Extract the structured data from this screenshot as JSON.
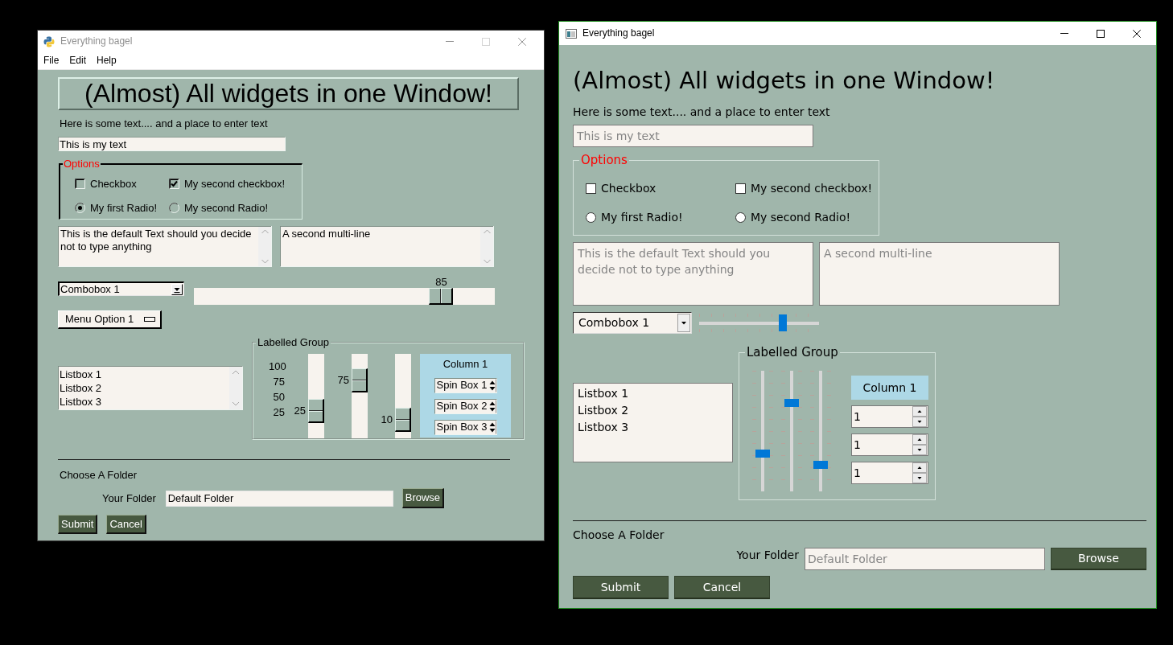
{
  "windows": [
    {
      "kind": "classic",
      "title": "Everything bagel",
      "active": false,
      "controls": [
        {
          "kind": "minimize",
          "disabled": false
        },
        {
          "kind": "maximize",
          "disabled": true
        },
        {
          "kind": "close",
          "disabled": false
        }
      ],
      "menu": [
        "File",
        "Edit",
        "Help"
      ],
      "heading": "(Almost) All widgets in one Window!",
      "intro": "Here is some text.... and a place to enter text",
      "text_input": {
        "value": "This is my text"
      },
      "options": {
        "title": "Options",
        "checkboxes": [
          {
            "label": "Checkbox",
            "checked": false
          },
          {
            "label": "My second checkbox!",
            "checked": true
          }
        ],
        "radios": [
          {
            "label": "My first Radio!",
            "selected": true
          },
          {
            "label": "My second Radio!",
            "selected": false
          }
        ]
      },
      "multilines": [
        {
          "value": "This is the default Text should you decide not to type anything"
        },
        {
          "value": "A second multi-line"
        }
      ],
      "combo": {
        "value": "Combobox 1"
      },
      "slider": {
        "level": 0.85,
        "reading": "85"
      },
      "option_menu": {
        "value": "Menu Option 1"
      },
      "listbox": {
        "items": [
          {
            "label": "Listbox 1",
            "selected": false
          },
          {
            "label": "Listbox 2",
            "selected": false
          },
          {
            "label": "Listbox 3",
            "selected": false
          }
        ]
      },
      "group": {
        "title": "Labelled Group",
        "scale_labels": [
          "100",
          "75",
          "50",
          "25"
        ],
        "sliders": [
          {
            "level": 0.25,
            "reading": "25"
          },
          {
            "level": 0.75,
            "reading": "75"
          },
          {
            "level": 0.1,
            "reading": "10"
          }
        ],
        "column": {
          "title": "Column 1",
          "spinboxes": [
            {
              "value": "Spin Box 1"
            },
            {
              "value": "Spin Box 2"
            },
            {
              "value": "Spin Box 3"
            }
          ]
        }
      },
      "folder": {
        "title": "Choose A Folder",
        "label": "Your Folder",
        "value": "Default Folder",
        "button": "Browse"
      },
      "buttons": [
        "Submit",
        "Cancel"
      ]
    },
    {
      "kind": "modern",
      "title": "Everything bagel",
      "active": true,
      "controls": [
        {
          "kind": "minimize",
          "disabled": false
        },
        {
          "kind": "maximize",
          "disabled": false
        },
        {
          "kind": "close",
          "disabled": false
        }
      ],
      "heading": "(Almost) All widgets in one Window!",
      "intro": "Here is some text.... and a place to enter text",
      "text_input": {
        "placeholder": "This is my text"
      },
      "options": {
        "title": "Options",
        "checkboxes": [
          {
            "label": "Checkbox",
            "checked": false
          },
          {
            "label": "My second checkbox!",
            "checked": false
          }
        ],
        "radios": [
          {
            "label": "My first Radio!",
            "selected": false
          },
          {
            "label": "My second Radio!",
            "selected": false
          }
        ]
      },
      "multilines": [
        {
          "placeholder": "This is the default Text should you decide not to type anything"
        },
        {
          "placeholder": "A second multi-line"
        }
      ],
      "combo": {
        "value": "Combobox 1"
      },
      "slider": {
        "level": 0.71
      },
      "listbox": {
        "items": [
          {
            "label": "Listbox 1",
            "selected": false
          },
          {
            "label": "Listbox 2",
            "selected": false
          },
          {
            "label": "Listbox 3",
            "selected": false
          }
        ]
      },
      "group": {
        "title": "Labelled Group",
        "sliders": [
          {
            "level": 0.3
          },
          {
            "level": 0.75
          },
          {
            "level": 0.2
          }
        ],
        "column": {
          "title": "Column 1",
          "spinboxes": [
            {
              "value": "1"
            },
            {
              "value": "1"
            },
            {
              "value": "1"
            }
          ]
        }
      },
      "folder": {
        "title": "Choose A Folder",
        "label": "Your Folder",
        "placeholder": "Default Folder",
        "button": "Browse"
      },
      "buttons": [
        "Submit",
        "Cancel"
      ]
    }
  ]
}
